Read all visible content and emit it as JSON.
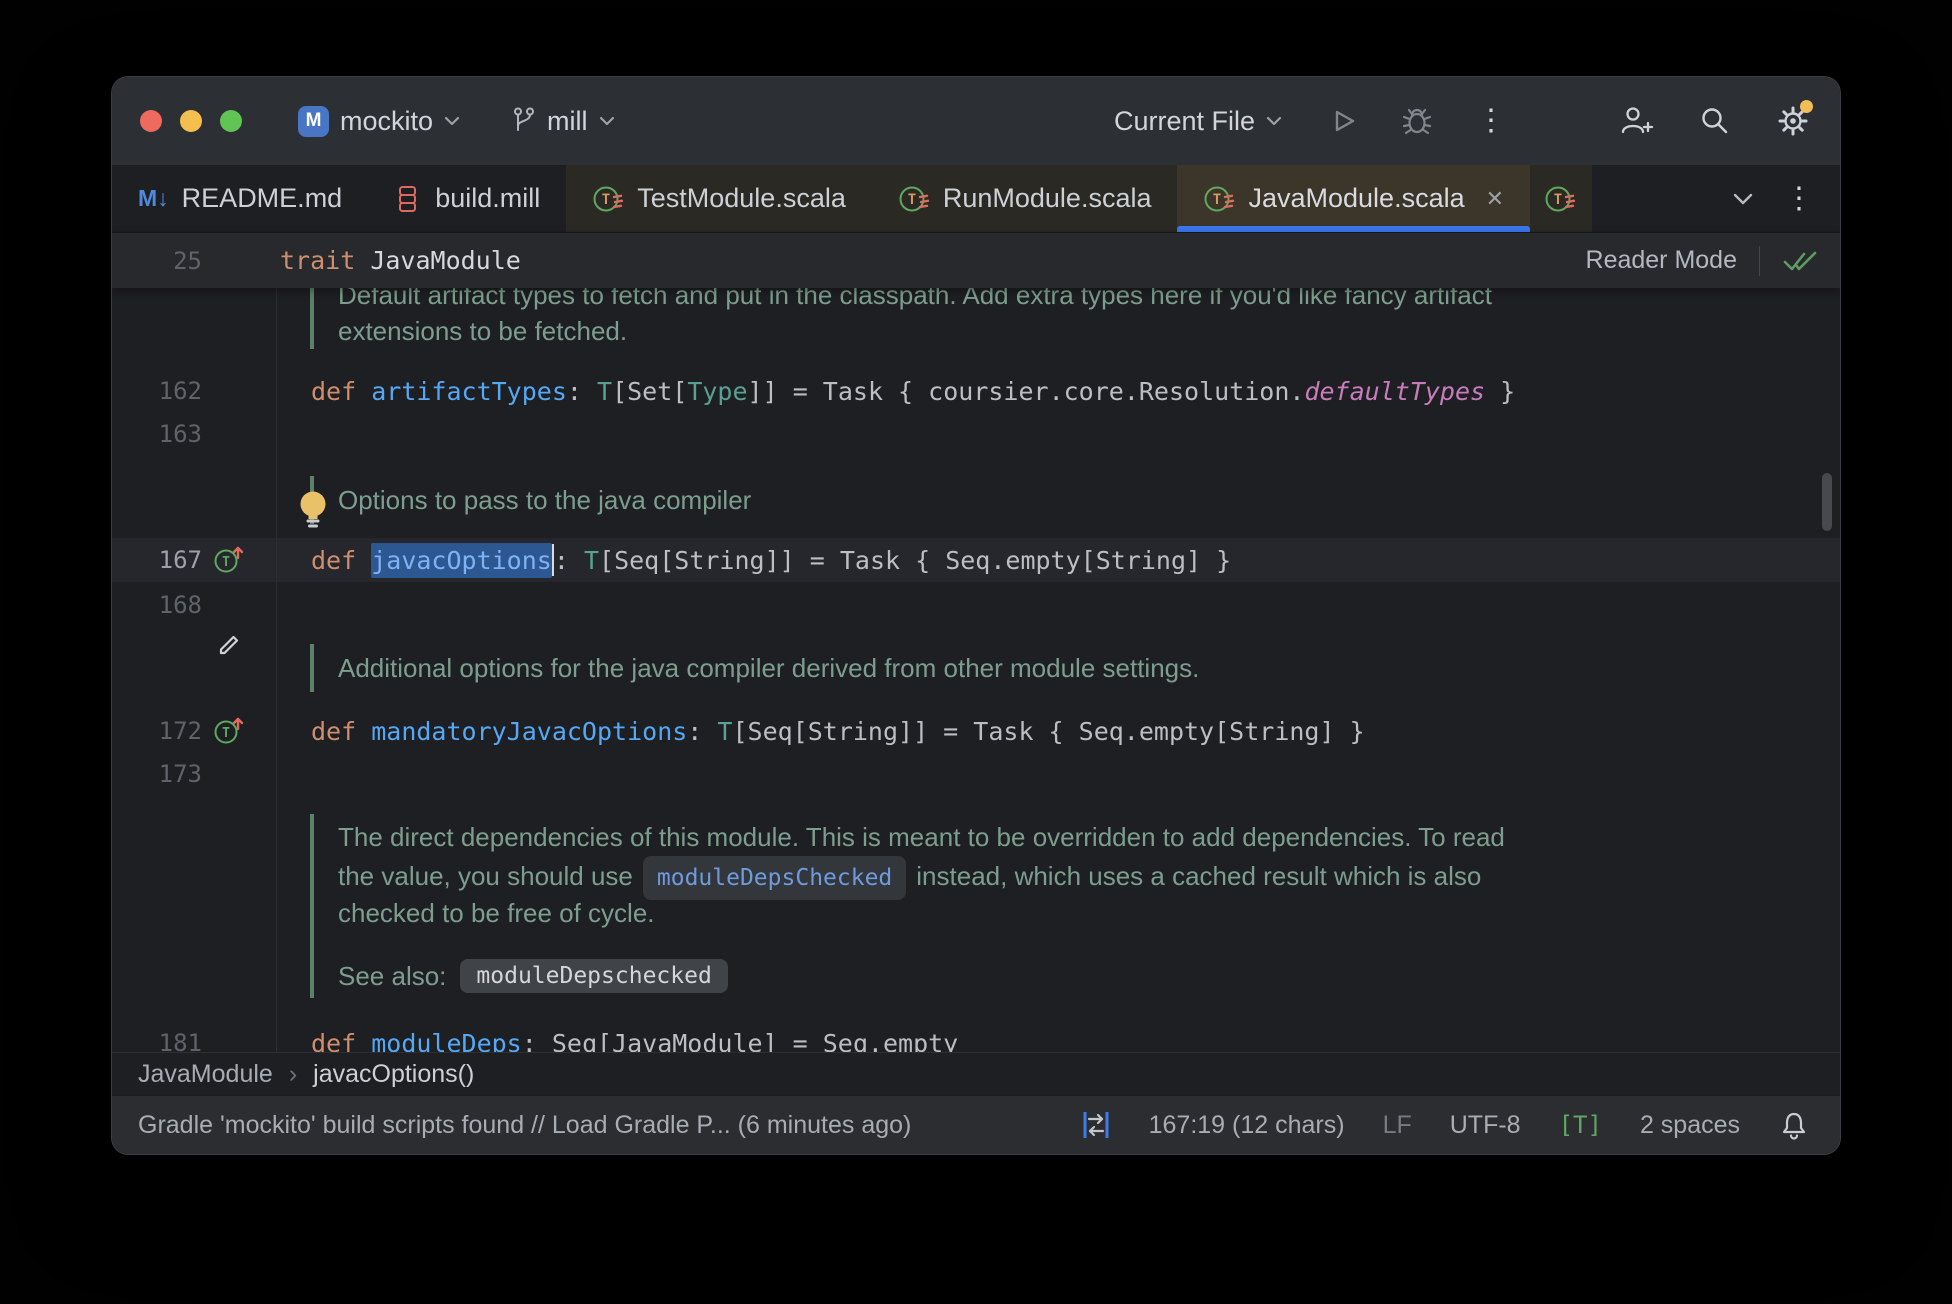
{
  "titlebar": {
    "project_badge": "M",
    "project_name": "mockito",
    "branch_name": "mill",
    "run_config": "Current File"
  },
  "glyphs": {
    "md": "M↓",
    "close": "✕",
    "kebab": "⋮",
    "crumb_sep": "›"
  },
  "tabs": {
    "readme": "README.md",
    "build": "build.mill",
    "test": "TestModule.scala",
    "run": "RunModule.scala",
    "java": "JavaModule.scala"
  },
  "sticky": {
    "line_no": "25",
    "keyword": "trait ",
    "title": "JavaModule",
    "reader_mode": "Reader Mode"
  },
  "gutter": {
    "n162": "162",
    "n163": "163",
    "n167": "167",
    "n168": "168",
    "n172": "172",
    "n173": "173",
    "n181": "181"
  },
  "docs": {
    "block1_line1": "Default artifact types to fetch and put in the classpath. Add extra types here if you'd like fancy artifact",
    "block1_line2": "extensions to be fetched.",
    "block2": "Options to pass to the java compiler",
    "block3": "Additional options for the java compiler derived from other module settings.",
    "para_line1": "The direct dependencies of this module. This is meant to be overridden to add dependencies. To read",
    "para_line2_pre": "the value, you should use",
    "para_chip": "moduleDepsChecked",
    "para_line2_post": "instead, which uses a cached result which is also",
    "para_line3": "checked to be free of cycle.",
    "see_also": "See also:",
    "see_chip": "moduleDepschecked"
  },
  "code": {
    "line162": {
      "kw": "def ",
      "name": "artifactTypes",
      "p1": ": ",
      "ty1": "T",
      "p2": "[Set[",
      "ty2": "Type",
      "p3": "]] = Task { coursier.core.Resolution.",
      "ref": "defaultTypes",
      "p4": " }"
    },
    "line167": {
      "kw": "def ",
      "sel": "javacOptions",
      "p1": ": ",
      "ty1": "T",
      "p2": "[Seq[String]] = Task { Seq.empty[String] }"
    },
    "line172": {
      "kw": "def ",
      "name": "mandatoryJavacOptions",
      "p1": ": ",
      "ty1": "T",
      "p2": "[Seq[String]] = Task { Seq.empty[String] }"
    },
    "line181": {
      "kw": "def ",
      "name": "moduleDeps",
      "p1": ": Seq[JavaModule] = Seq.empty"
    }
  },
  "breadcrumbs": {
    "item1": "JavaModule",
    "item2": "javacOptions()"
  },
  "statusbar": {
    "message": "Gradle 'mockito' build scripts found // Load Gradle P... (6 minutes ago)",
    "position": "167:19 (12 chars)",
    "line_sep": "LF",
    "encoding": "UTF-8",
    "highlight_level": "[T]",
    "indent": "2 spaces"
  },
  "colors": {
    "accent_blue": "#3B77ED",
    "tab_active_bg": "#3B352A",
    "selection_bg": "#2D5791",
    "doc_green": "#7D9E8E",
    "warning_dot": "#F2BE55",
    "keyword_orange": "#CF8E6D",
    "function_blue": "#56A8F5"
  }
}
